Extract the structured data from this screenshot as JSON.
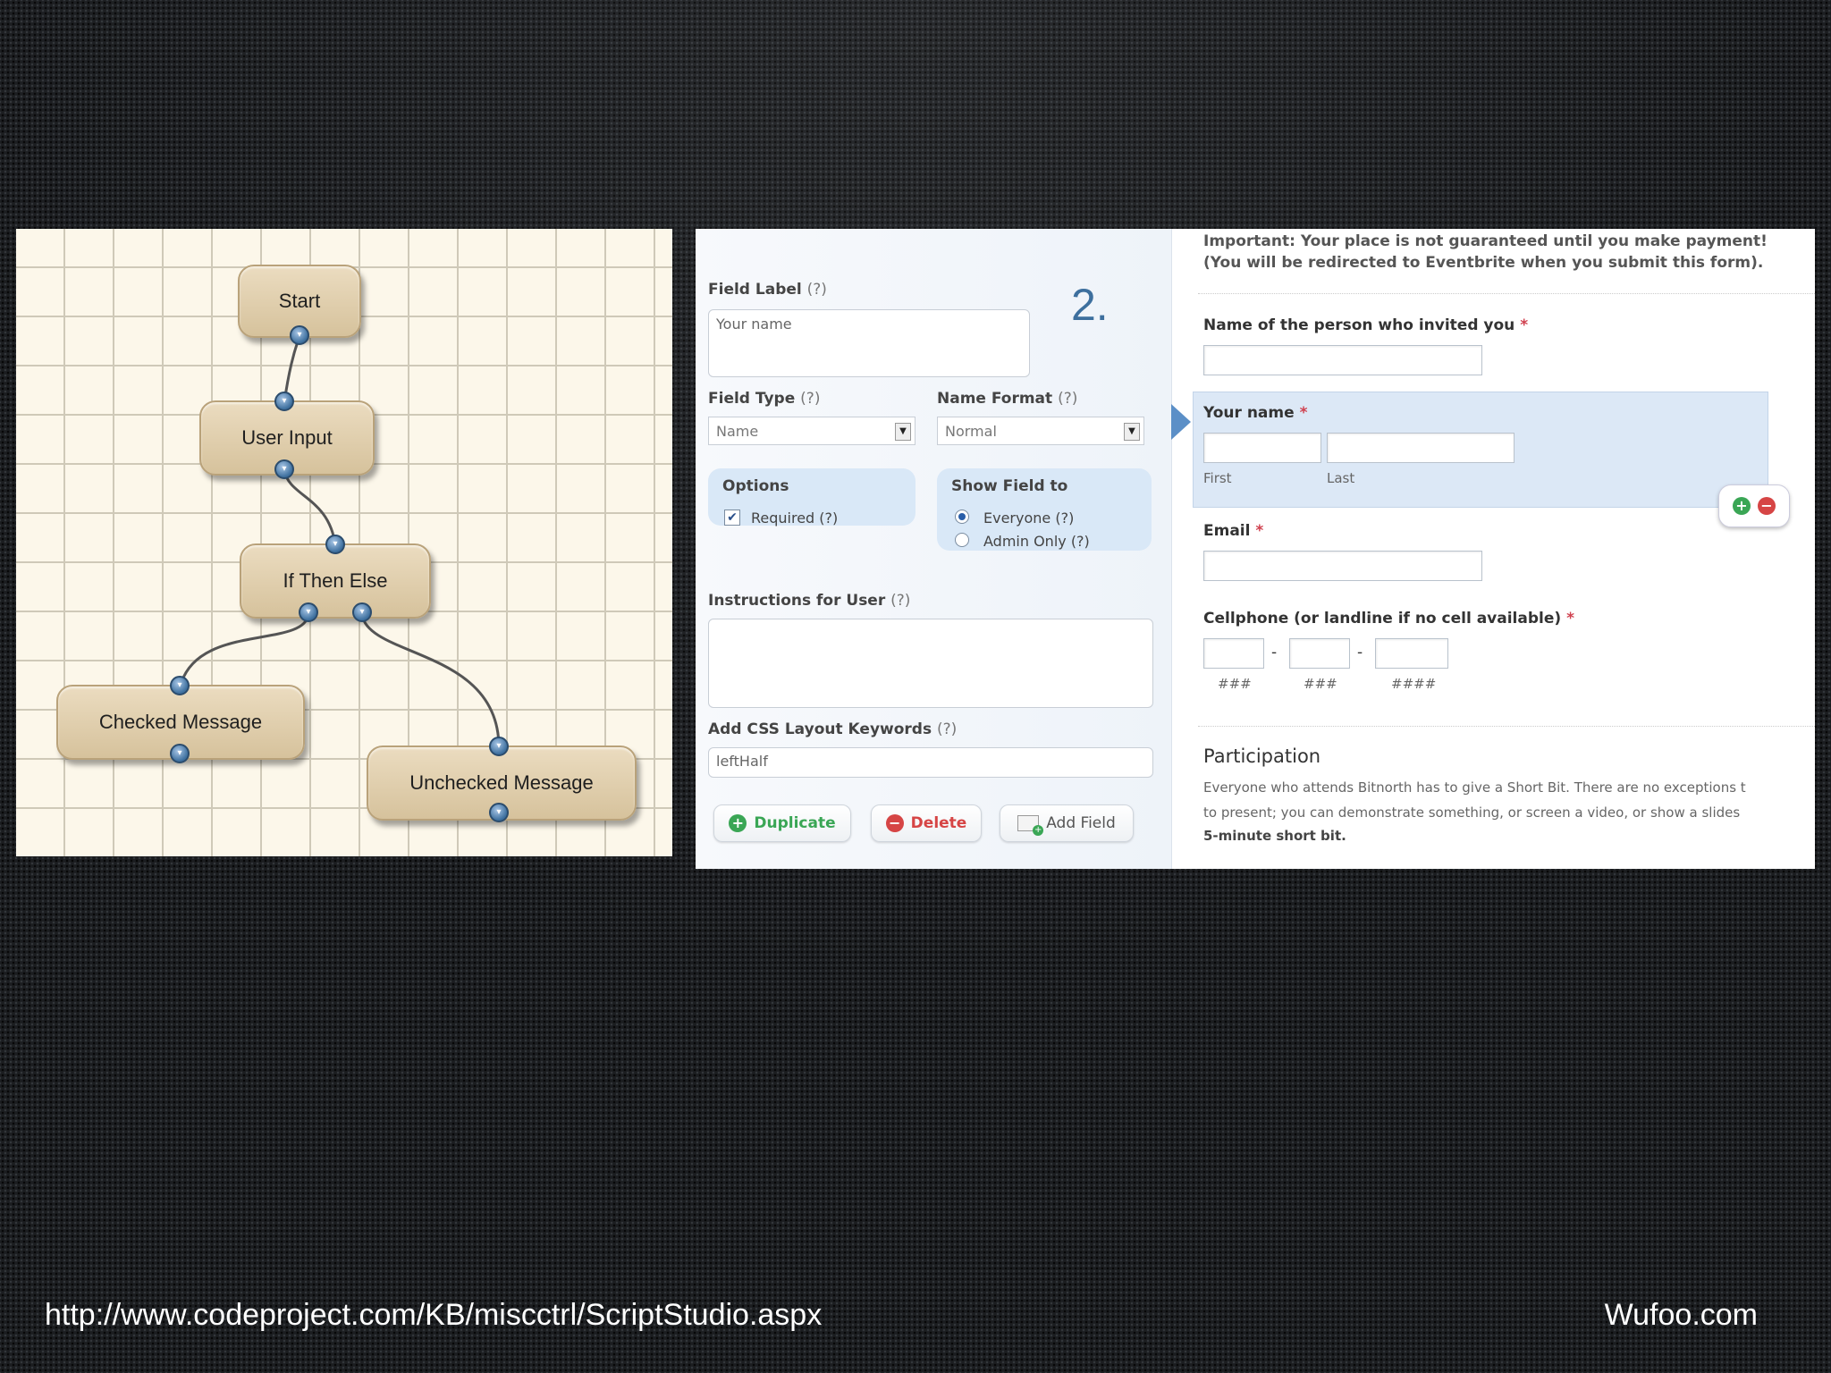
{
  "flow": {
    "nodes": {
      "start": "Start",
      "user_input": "User Input",
      "if_then_else": "If Then Else",
      "checked": "Checked Message",
      "unchecked": "Unchecked Message"
    }
  },
  "builder": {
    "step": "2.",
    "field_label": {
      "label": "Field Label",
      "help": "(?)",
      "value": "Your name"
    },
    "field_type": {
      "label": "Field Type",
      "help": "(?)",
      "value": "Name"
    },
    "name_format": {
      "label": "Name Format",
      "help": "(?)",
      "value": "Normal"
    },
    "options": {
      "title": "Options",
      "required": "Required (?)",
      "required_checked": true
    },
    "show_field": {
      "title": "Show Field to",
      "everyone": "Everyone (?)",
      "admin": "Admin Only (?)",
      "selected": "everyone"
    },
    "instructions": {
      "label": "Instructions for User",
      "help": "(?)",
      "value": ""
    },
    "css": {
      "label": "Add CSS Layout Keywords",
      "help": "(?)",
      "value": "leftHalf"
    },
    "buttons": {
      "duplicate": "Duplicate",
      "delete": "Delete",
      "add": "Add Field"
    }
  },
  "preview": {
    "notice_line1": "Important: Your place is not guaranteed until you make payment!",
    "notice_line2": "(You will be redirected to Eventbrite when you submit this form).",
    "invited_label": "Name of the person who invited you",
    "your_name_label": "Your name",
    "first": "First",
    "last": "Last",
    "email_label": "Email",
    "cell_label": "Cellphone (or landline if no cell available)",
    "phone_hint_1": "###",
    "phone_hint_2": "###",
    "phone_hint_3": "####",
    "dash": "-",
    "required_mark": "*",
    "participation_title": "Participation",
    "participation_line1": "Everyone who attends Bitnorth has to give a Short Bit. There are no exceptions t",
    "participation_line2": "to present; you can demonstrate something, or screen a video, or show a slides",
    "participation_line3": "5-minute short bit."
  },
  "captions": {
    "left": "http://www.codeproject.com/KB/miscctrl/ScriptStudio.aspx",
    "right": "Wufoo.com"
  },
  "colors": {
    "accent": "#3d6f9e",
    "required": "#d0414f",
    "duplicate": "#3aa655",
    "delete": "#d64545"
  },
  "icons": {
    "port": "port-connector-icon",
    "check": "checkbox-check-icon",
    "plus": "plus-circle-icon",
    "minus": "minus-circle-icon",
    "add_field": "add-field-icon",
    "dropdown": "dropdown-arrow-icon"
  }
}
